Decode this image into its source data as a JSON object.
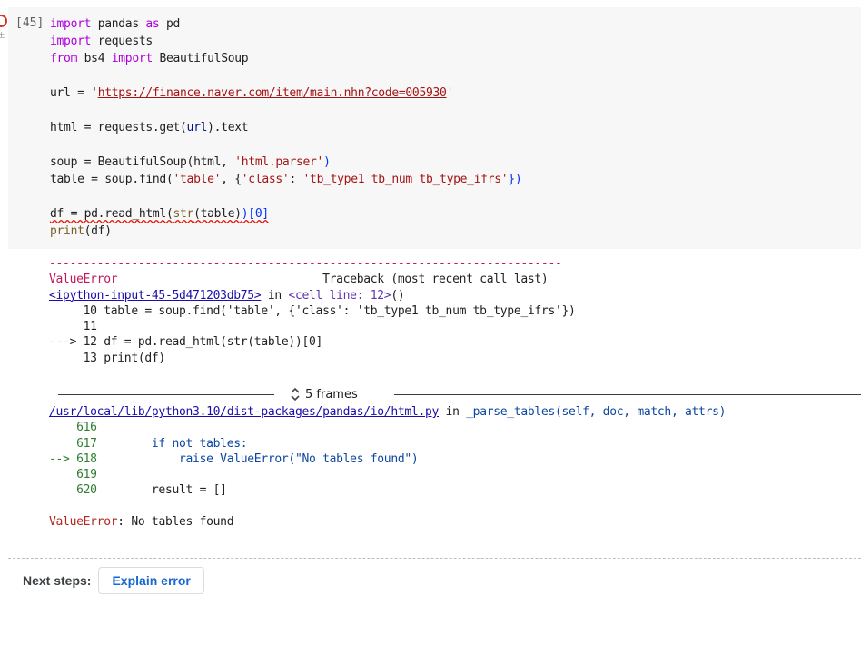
{
  "cell": {
    "execution_count": "[45]",
    "indicator_glyph": "土",
    "code": {
      "line1_kw": "import",
      "line1_mod": " pandas ",
      "line1_as": "as",
      "line1_alias": " pd",
      "line2_kw": "import",
      "line2_mod": " requests",
      "line3_from": "from",
      "line3_mod": " bs4 ",
      "line3_import": "import",
      "line3_name": " BeautifulSoup",
      "line5_pre": "url = '",
      "line5_url": "https://finance.naver.com/item/main.nhn?code=005930",
      "line5_post": "'",
      "line7_pre": "html = requests.get(",
      "line7_arg": "url",
      "line7_post": ").text",
      "line9_pre": "soup = BeautifulSoup(",
      "line9_arg": "html",
      "line9_mid": ", ",
      "line9_str": "'html.parser'",
      "line9_post": ")",
      "line10_pre": "table = soup.find(",
      "line10_s1": "'table'",
      "line10_mid": ", {",
      "line10_s2": "'class'",
      "line10_colon": ": ",
      "line10_s3": "'tb_type1 tb_num tb_type_ifrs'",
      "line10_post": "})",
      "line12_pre": "df = pd.read_html(",
      "line12_fn": "str",
      "line12_arg": "(table)",
      "line12_idx": ")[0]",
      "line13_fn": "print",
      "line13_arg": "(df)"
    }
  },
  "traceback": {
    "rule": "---------------------------------------------------------------------------",
    "error_name": "ValueError",
    "header_right": "                              Traceback (most recent call last)",
    "input_link": "<ipython-input-45-5d471203db75>",
    "in_text": " in ",
    "cell_line": "<cell line: 12>",
    "cell_line_post": "()",
    "ln10": "     10 table = soup.find('table', {'class': 'tb_type1 tb_num tb_type_ifrs'})",
    "ln11": "     11",
    "ln12_arrow": "---> 12 df = pd.read_html(str(table))[0]",
    "ln13": "     13 print(df)",
    "frames_label": "5 frames",
    "file_link": "/usr/local/lib/python3.10/dist-packages/pandas/io/html.py",
    "func_in": " in ",
    "func_name": "_parse_tables",
    "func_args": "(self, doc, match, attrs)",
    "f616": "    616",
    "f617_num": "    617",
    "f617_code": "        if not tables:",
    "f618_arrow": "--> 618",
    "f618_code": "            raise ValueError(\"No tables found\")",
    "f619": "    619",
    "f620_num": "    620",
    "f620_code": "        result = []",
    "final_name": "ValueError",
    "final_msg": ": No tables found"
  },
  "footer": {
    "next_steps_label": "Next steps:",
    "explain_button": "Explain error"
  }
}
